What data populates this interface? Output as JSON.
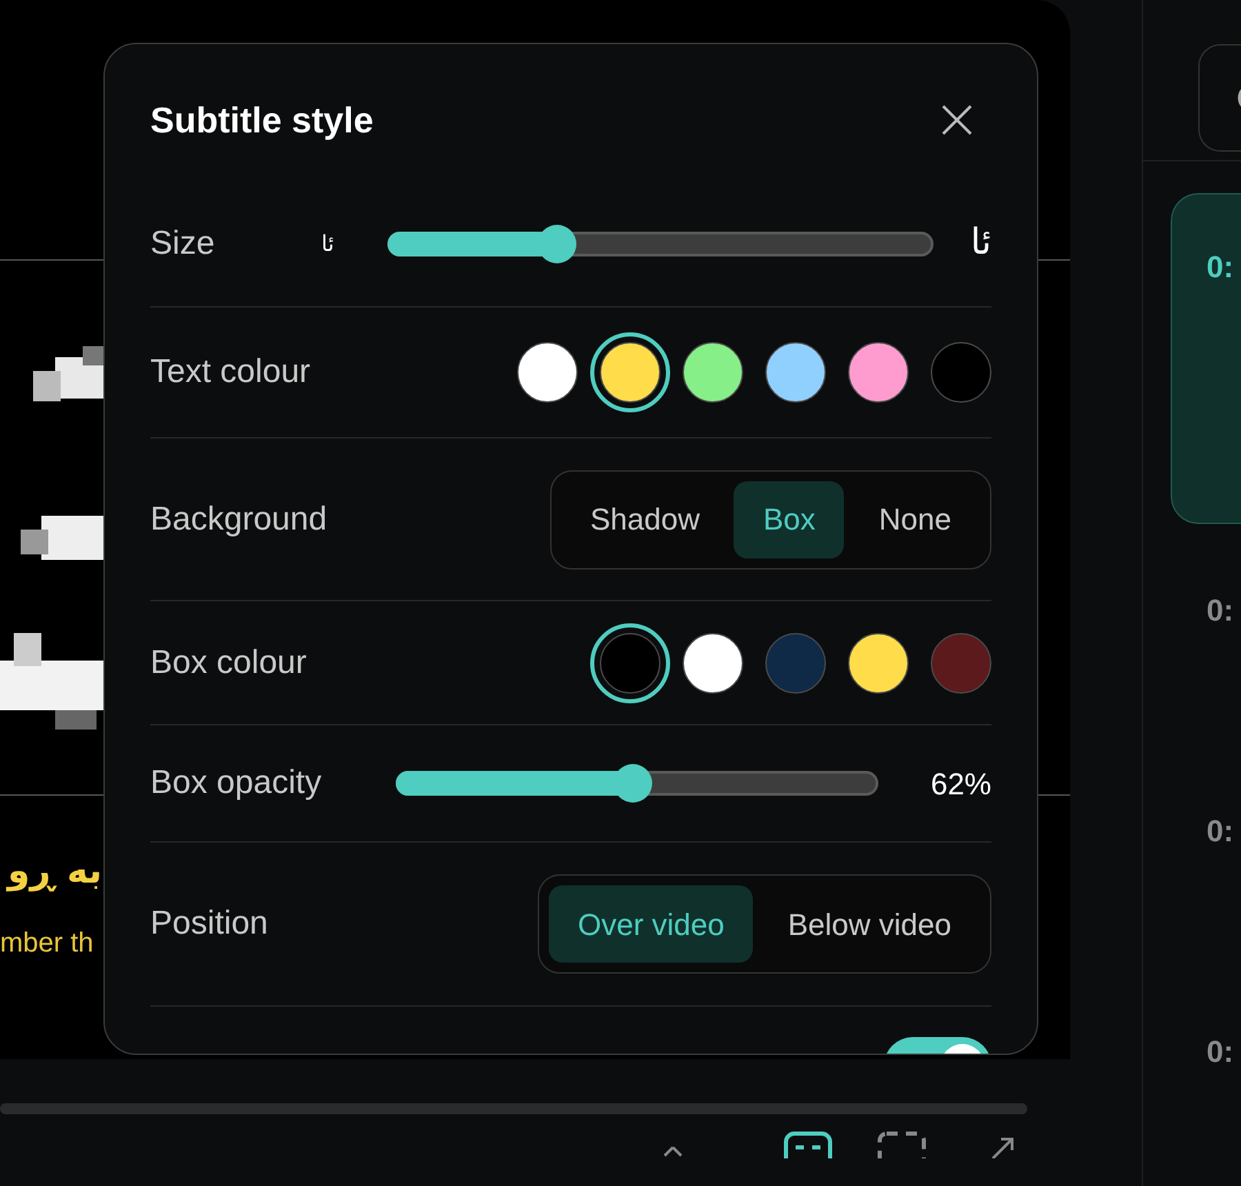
{
  "video": {
    "subtitle_lines": [
      {
        "kind": "arabic",
        "text": "به ڕو"
      },
      {
        "kind": "latin",
        "text": "mber th"
      }
    ]
  },
  "dialog": {
    "title": "Subtitle style",
    "rows": [
      {
        "kind": "slider",
        "label": "Size",
        "small_glyph": "ئا",
        "large_glyph": "ئا",
        "level": 0.31
      },
      {
        "kind": "swatches",
        "label": "Text colour",
        "swatches": [
          {
            "color": "#ffffff",
            "selected": false
          },
          {
            "color": "#ffdd4a",
            "selected": true
          },
          {
            "color": "#86ef88",
            "selected": false
          },
          {
            "color": "#90d0ff",
            "selected": false
          },
          {
            "color": "#ff9ccf",
            "selected": false
          },
          {
            "color": "#000000",
            "selected": false
          }
        ]
      },
      {
        "kind": "segmented",
        "label": "Background",
        "options": [
          {
            "label": "Shadow",
            "selected": false
          },
          {
            "label": "Box",
            "selected": true
          },
          {
            "label": "None",
            "selected": false
          }
        ]
      },
      {
        "kind": "swatches",
        "label": "Box colour",
        "swatches": [
          {
            "color": "#000000",
            "selected": true
          },
          {
            "color": "#ffffff",
            "selected": false
          },
          {
            "color": "#0f2a47",
            "selected": false
          },
          {
            "color": "#ffdd4a",
            "selected": false
          },
          {
            "color": "#5c1a1c",
            "selected": false
          }
        ]
      },
      {
        "kind": "slider",
        "label": "Box opacity",
        "reading": "62%",
        "level": 0.49
      },
      {
        "kind": "segmented",
        "label": "Position",
        "options": [
          {
            "label": "Over video",
            "selected": true
          },
          {
            "label": "Below video",
            "selected": false
          }
        ]
      },
      {
        "kind": "toggle",
        "on": true
      }
    ]
  },
  "cues": [
    {
      "time": "0:",
      "selected": true
    },
    {
      "time": "0:",
      "selected": false
    },
    {
      "time": "0:",
      "selected": false
    },
    {
      "time": "0:",
      "selected": false
    }
  ]
}
